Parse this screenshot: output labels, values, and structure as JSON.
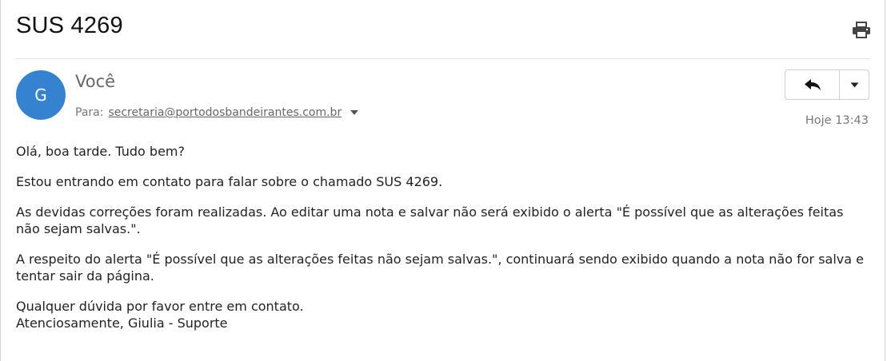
{
  "email": {
    "subject": "SUS 4269",
    "sender": {
      "avatar_letter": "G",
      "name": "Você",
      "avatar_color": "#3583d0"
    },
    "to_label": "Para:",
    "to_address": "secretaria@portodosbandeirantes.com.br",
    "time": "Hoje 13:43",
    "body": {
      "greeting": "Olá, boa tarde. Tudo bem?",
      "p1": "Estou entrando em contato para falar sobre o chamado SUS 4269.",
      "p2": "As devidas correções foram realizadas. Ao editar uma nota e salvar não será exibido o alerta \"É possível que as alterações feitas não sejam salvas.\".",
      "p3": "A respeito do alerta \"É possível que as alterações feitas não sejam salvas.\", continuará sendo exibido quando a nota não for salva e tentar sair da página.",
      "closing": "Qualquer dúvida por favor entre em contato.",
      "signature": "Atenciosamente, Giulia - Suporte"
    }
  },
  "icons": {
    "print": "print-icon",
    "reply": "reply-icon",
    "more": "chevron-down-icon",
    "recipients": "caret-down-icon"
  }
}
